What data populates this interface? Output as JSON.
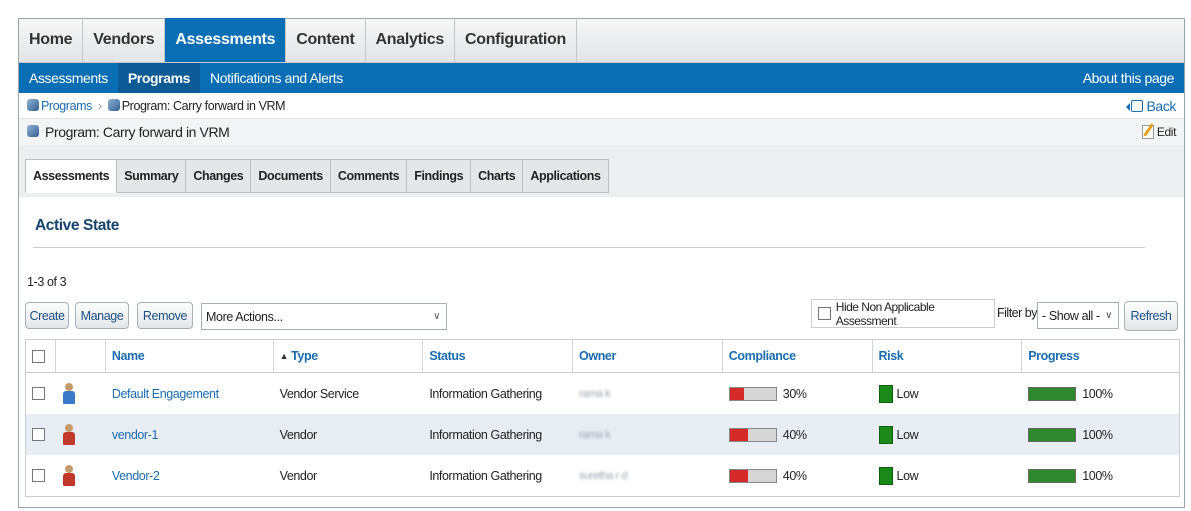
{
  "topnav": {
    "tabs": [
      {
        "label": "Home",
        "active": false
      },
      {
        "label": "Vendors",
        "active": false
      },
      {
        "label": "Assessments",
        "active": true
      },
      {
        "label": "Content",
        "active": false
      },
      {
        "label": "Analytics",
        "active": false
      },
      {
        "label": "Configuration",
        "active": false
      }
    ]
  },
  "subnav": {
    "items": [
      {
        "label": "Assessments",
        "active": false
      },
      {
        "label": "Programs",
        "active": true
      },
      {
        "label": "Notifications and Alerts",
        "active": false
      }
    ],
    "about": "About this page"
  },
  "breadcrumb": {
    "root": "Programs",
    "current": "Program: Carry forward in VRM",
    "back": "Back"
  },
  "title": {
    "text": "Program: Carry forward in VRM",
    "edit": "Edit"
  },
  "tabs": [
    {
      "label": "Assessments",
      "active": true
    },
    {
      "label": "Summary",
      "active": false
    },
    {
      "label": "Changes",
      "active": false
    },
    {
      "label": "Documents",
      "active": false
    },
    {
      "label": "Comments",
      "active": false
    },
    {
      "label": "Findings",
      "active": false
    },
    {
      "label": "Charts",
      "active": false
    },
    {
      "label": "Applications",
      "active": false
    }
  ],
  "section": {
    "title": "Active State",
    "count": "1-3 of 3"
  },
  "toolbar": {
    "create": "Create",
    "manage": "Manage",
    "remove": "Remove",
    "more_actions": "More Actions...",
    "hide_na": "Hide Non Applicable Assessment",
    "filter_label": "Filter by",
    "filter_value": "- Show all -",
    "refresh": "Refresh"
  },
  "table": {
    "headers": {
      "name": "Name",
      "type": "Type",
      "status": "Status",
      "owner": "Owner",
      "compliance": "Compliance",
      "risk": "Risk",
      "progress": "Progress"
    },
    "rows": [
      {
        "name": "Default Engagement",
        "type": "Vendor Service",
        "status": "Information Gathering",
        "owner": "rama k",
        "compliance": "30%",
        "compliance_value": 0.3,
        "risk": "Low",
        "progress": "100%",
        "progress_value": 1.0,
        "icon_color": "#3a78c8"
      },
      {
        "name": "vendor-1",
        "type": "Vendor",
        "status": "Information Gathering",
        "owner": "rama k",
        "compliance": "40%",
        "compliance_value": 0.4,
        "risk": "Low",
        "progress": "100%",
        "progress_value": 1.0,
        "icon_color": "#c0392b"
      },
      {
        "name": "Vendor-2",
        "type": "Vendor",
        "status": "Information Gathering",
        "owner": "suretha r d",
        "compliance": "40%",
        "compliance_value": 0.4,
        "risk": "Low",
        "progress": "100%",
        "progress_value": 1.0,
        "icon_color": "#c0392b"
      }
    ]
  },
  "colors": {
    "primary_nav": "#0a6eb4",
    "link": "#1b6bb0",
    "risk_low": "#1b8a1b",
    "compliance_bar": "#d42a2a",
    "progress_bar": "#2f8a2f"
  }
}
